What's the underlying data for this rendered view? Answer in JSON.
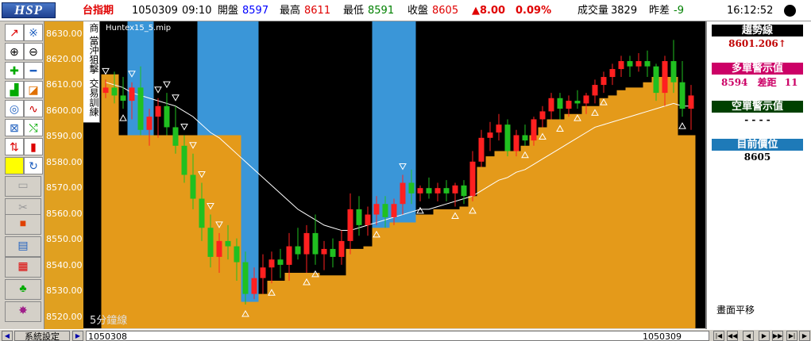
{
  "header": {
    "logo": "HSP",
    "symbol": "台指期",
    "date": "1050309",
    "time": "09:10",
    "open_label": "開盤",
    "open": "8597",
    "high_label": "最高",
    "high": "8611",
    "low_label": "最低",
    "low": "8591",
    "close_label": "收盤",
    "close": "8605",
    "change": "▲8.00",
    "change_pct": "0.09%",
    "volume_label": "成交量",
    "volume": "3829",
    "spread_label": "昨差",
    "spread": "-9",
    "clock": "16:12:52"
  },
  "side_tabs": [
    "商",
    "當沖狙擊",
    "交易訓練"
  ],
  "chart": {
    "file_label": "Huntex15_5.mip",
    "period_label": "5分鐘線",
    "y_ticks": [
      "8630.00",
      "8620.00",
      "8610.00",
      "8600.00",
      "8590.00",
      "8580.00",
      "8570.00",
      "8560.00",
      "8550.00",
      "8540.00",
      "8530.00",
      "8520.00"
    ],
    "x_start": "1050308",
    "x_mid": "1050309"
  },
  "panel": {
    "trend_label": "趨勢線",
    "trend_value": "8601.206↑",
    "long_label": "多單警示值",
    "long_value": "8594",
    "gap_label": "差距",
    "gap_value": "11",
    "short_label": "空單警示值",
    "short_value": "- - - -",
    "position_label": "目前價位",
    "position_value": "8605",
    "note": "畫面平移",
    "colors": {
      "trend": "#000000",
      "long": "#cc0066",
      "short": "#004000",
      "position": "#1e7ab8"
    }
  },
  "status": {
    "settings_button": "系統設定"
  },
  "chart_data": {
    "type": "candlestick",
    "y_range": [
      8517,
      8633
    ],
    "candles": [
      [
        8606,
        8611,
        8604,
        8608
      ],
      [
        8608,
        8614,
        8602,
        8605
      ],
      [
        8605,
        8612,
        8600,
        8603
      ],
      [
        8603,
        8610,
        8596,
        8608
      ],
      [
        8608,
        8616,
        8590,
        8592
      ],
      [
        8592,
        8600,
        8586,
        8597
      ],
      [
        8597,
        8604,
        8589,
        8601
      ],
      [
        8601,
        8606,
        8590,
        8593
      ],
      [
        8593,
        8601,
        8583,
        8586
      ],
      [
        8586,
        8590,
        8572,
        8575
      ],
      [
        8575,
        8583,
        8562,
        8566
      ],
      [
        8566,
        8572,
        8550,
        8555
      ],
      [
        8555,
        8560,
        8540,
        8544
      ],
      [
        8544,
        8553,
        8538,
        8550
      ],
      [
        8550,
        8556,
        8543,
        8548
      ],
      [
        8548,
        8551,
        8535,
        8542
      ],
      [
        8542,
        8546,
        8526,
        8530
      ],
      [
        8530,
        8540,
        8528,
        8536
      ],
      [
        8536,
        8545,
        8530,
        8540
      ],
      [
        8540,
        8546,
        8534,
        8543
      ],
      [
        8543,
        8547,
        8536,
        8541
      ],
      [
        8541,
        8553,
        8535,
        8548
      ],
      [
        8548,
        8555,
        8543,
        8545
      ],
      [
        8545,
        8556,
        8538,
        8553
      ],
      [
        8553,
        8560,
        8541,
        8545
      ],
      [
        8545,
        8550,
        8539,
        8547
      ],
      [
        8547,
        8551,
        8540,
        8544
      ],
      [
        8544,
        8554,
        8541,
        8550
      ],
      [
        8550,
        8568,
        8545,
        8562
      ],
      [
        8562,
        8567,
        8552,
        8556
      ],
      [
        8556,
        8563,
        8552,
        8560
      ],
      [
        8560,
        8567,
        8556,
        8564
      ],
      [
        8564,
        8567,
        8555,
        8559
      ],
      [
        8559,
        8566,
        8556,
        8564
      ],
      [
        8564,
        8575,
        8560,
        8572
      ],
      [
        8572,
        8577,
        8564,
        8568
      ],
      [
        8568,
        8571,
        8565,
        8570
      ],
      [
        8570,
        8574,
        8566,
        8568
      ],
      [
        8568,
        8572,
        8565,
        8570
      ],
      [
        8570,
        8573,
        8565,
        8568
      ],
      [
        8568,
        8572,
        8563,
        8571
      ],
      [
        8571,
        8573,
        8564,
        8567
      ],
      [
        8567,
        8584,
        8565,
        8580
      ],
      [
        8580,
        8592,
        8578,
        8589
      ],
      [
        8589,
        8595,
        8584,
        8591
      ],
      [
        8591,
        8598,
        8588,
        8594
      ],
      [
        8594,
        8596,
        8582,
        8584
      ],
      [
        8584,
        8592,
        8582,
        8590
      ],
      [
        8590,
        8594,
        8586,
        8588
      ],
      [
        8588,
        8597,
        8586,
        8596
      ],
      [
        8596,
        8601,
        8593,
        8599
      ],
      [
        8599,
        8606,
        8596,
        8604
      ],
      [
        8604,
        8606,
        8596,
        8600
      ],
      [
        8600,
        8605,
        8597,
        8603
      ],
      [
        8603,
        8607,
        8600,
        8602
      ],
      [
        8602,
        8606,
        8598,
        8605
      ],
      [
        8605,
        8611,
        8602,
        8609
      ],
      [
        8609,
        8614,
        8606,
        8612
      ],
      [
        8612,
        8617,
        8609,
        8615
      ],
      [
        8615,
        8620,
        8612,
        8618
      ],
      [
        8618,
        8620,
        8612,
        8616
      ],
      [
        8616,
        8621,
        8614,
        8618
      ],
      [
        8618,
        8622,
        8612,
        8616
      ],
      [
        8616,
        8617,
        8603,
        8606
      ],
      [
        8606,
        8620,
        8601,
        8618
      ],
      [
        8618,
        8626,
        8606,
        8610
      ],
      [
        8610,
        8618,
        8597,
        8600
      ],
      [
        8600,
        8609,
        8592,
        8605
      ]
    ],
    "ma_line": [
      8610,
      8609,
      8608,
      8606,
      8605,
      8604,
      8603,
      8602,
      8601,
      8599,
      8597,
      8594,
      8591,
      8589,
      8586,
      8583,
      8580,
      8577,
      8574,
      8571,
      8568,
      8565,
      8562,
      8560,
      8558,
      8556,
      8555,
      8554,
      8554,
      8555,
      8556,
      8557,
      8558,
      8559,
      8560,
      8561,
      8562,
      8562,
      8563,
      8564,
      8565,
      8566,
      8567,
      8569,
      8571,
      8573,
      8574,
      8576,
      8577,
      8579,
      8581,
      8583,
      8585,
      8587,
      8589,
      8591,
      8593,
      8594,
      8595,
      8596,
      8597,
      8598,
      8599,
      8600,
      8601,
      8602,
      8601,
      8601
    ],
    "stop_line": [
      8613,
      8613,
      8590,
      8590,
      8590,
      8590,
      8590,
      8590,
      8590,
      8590,
      8590,
      8590,
      8590,
      8590,
      8590,
      8590,
      8527,
      8527,
      8530,
      8535,
      8535,
      8538,
      8538,
      8538,
      8538,
      8537,
      8537,
      8537,
      8547,
      8547,
      8548,
      8555,
      8555,
      8557,
      8557,
      8557,
      8560,
      8560,
      8562,
      8562,
      8562,
      8563,
      8567,
      8578,
      8582,
      8584,
      8584,
      8584,
      8586,
      8590,
      8593,
      8596,
      8596,
      8598,
      8598,
      8601,
      8601,
      8604,
      8605,
      8607,
      8608,
      8608,
      8610,
      8612,
      8612,
      8612,
      8590,
      8590
    ],
    "short_zones": [
      [
        3,
        5
      ],
      [
        11,
        17
      ],
      [
        31,
        35
      ]
    ],
    "up_markers": [
      2,
      16,
      19,
      23,
      24,
      31,
      36,
      40,
      42,
      48,
      50,
      52,
      54,
      56,
      57,
      66
    ],
    "down_markers": [
      0,
      3,
      6,
      7,
      8,
      9,
      10,
      11,
      12,
      13,
      34
    ]
  }
}
